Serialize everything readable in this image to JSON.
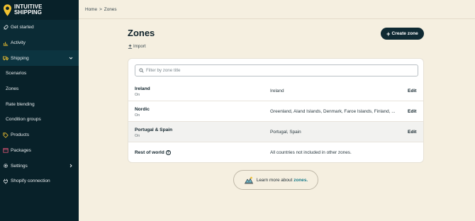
{
  "brand": {
    "name_line1": "INTUITIVE",
    "name_line2": "SHIPPING"
  },
  "sidebar": {
    "items": [
      {
        "label": "Get started",
        "icon": "rocket-icon"
      },
      {
        "label": "Activity",
        "icon": "chart-icon"
      },
      {
        "label": "Shipping",
        "icon": "truck-icon"
      },
      {
        "label": "Scenarios"
      },
      {
        "label": "Zones"
      },
      {
        "label": "Rate blending"
      },
      {
        "label": "Condition groups"
      },
      {
        "label": "Products",
        "icon": "tag-icon"
      },
      {
        "label": "Packages",
        "icon": "box-icon"
      },
      {
        "label": "Settings",
        "icon": "gear-icon"
      },
      {
        "label": "Shopify connection",
        "icon": "plug-icon"
      }
    ]
  },
  "breadcrumb": {
    "home": "Home",
    "separator": ">",
    "current": "Zones"
  },
  "page": {
    "title": "Zones",
    "import_label": "Import",
    "create_label": "Create zone",
    "filter_placeholder": "Filter by zone title"
  },
  "zones": [
    {
      "name": "Ireland",
      "status": "On",
      "countries": "Ireland",
      "edit": "Edit"
    },
    {
      "name": "Nordic",
      "status": "On",
      "countries": "Greenland, Aland Islands, Denmark, Faroe Islands, Finland, ...",
      "edit": "Edit"
    },
    {
      "name": "Portugal & Spain",
      "status": "On",
      "countries": "Portugal, Spain",
      "edit": "Edit"
    },
    {
      "name": "Rest of world",
      "countries": "All countries not included in other zones."
    }
  ],
  "learn_more": {
    "text": "Learn more about",
    "link": "zones."
  },
  "colors": {
    "sidebar": "#082129",
    "background": "#f5efe0",
    "primary_button": "#0f2a33",
    "link": "#177a8a",
    "logo_pin": "#f2c230"
  }
}
